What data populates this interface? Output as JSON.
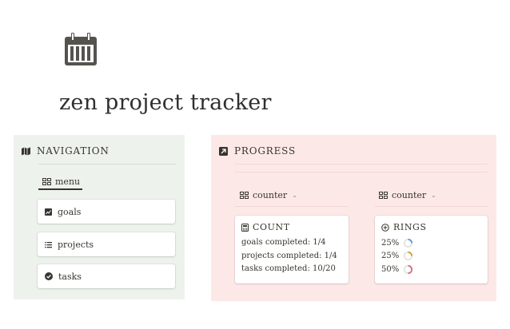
{
  "page": {
    "icon": "calendar-icon",
    "title": "zen project tracker"
  },
  "navigation": {
    "header_icon": "map-icon",
    "header": "NAVIGATION",
    "tab_icon": "board-view-icon",
    "tab_label": "menu",
    "items": [
      {
        "icon": "chart-icon",
        "label": "goals"
      },
      {
        "icon": "list-icon",
        "label": "projects"
      },
      {
        "icon": "check-circle-icon",
        "label": "tasks"
      }
    ]
  },
  "progress": {
    "header_icon": "arrow-up-right-icon",
    "header": "PROGRESS",
    "views": [
      {
        "icon": "board-view-icon",
        "label": "counter",
        "chevron": "chevron-down-icon"
      },
      {
        "icon": "board-view-icon",
        "label": "counter",
        "chevron": "chevron-down-icon"
      }
    ],
    "count_card": {
      "icon": "calculator-icon",
      "title": "COUNT",
      "lines": [
        "goals completed: 1/4",
        "projects completed: 1/4",
        "tasks completed: 10/20"
      ]
    },
    "rings_card": {
      "icon": "circle-plus-icon",
      "title": "RINGS",
      "rings": [
        {
          "label": "25%",
          "value": 0.25,
          "color": "#5b9bd5"
        },
        {
          "label": "25%",
          "value": 0.25,
          "color": "#c9a227"
        },
        {
          "label": "50%",
          "value": 0.5,
          "color": "#d4708a"
        }
      ]
    }
  },
  "colors": {
    "nav_bg": "#edf3ec",
    "progress_bg": "#fde8e8",
    "text": "#37352f"
  }
}
